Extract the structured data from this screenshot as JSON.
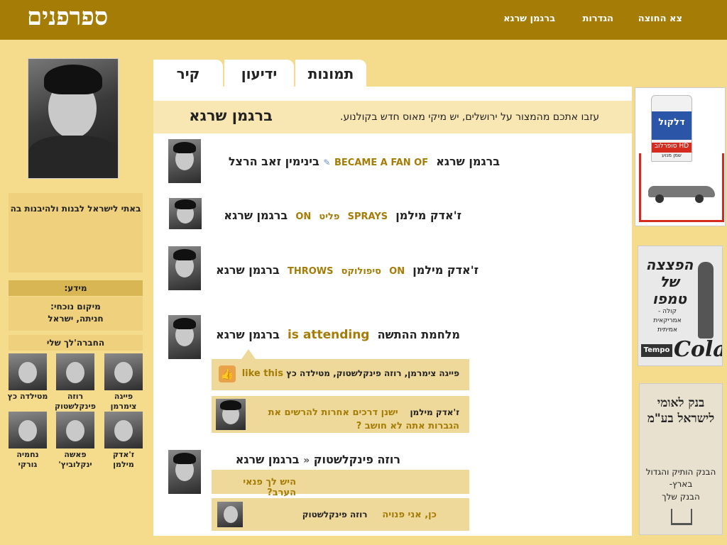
{
  "header": {
    "logo": "ספרפנים",
    "nav": [
      "צא החוצה",
      "הגדרות",
      "ברגמן שרגא"
    ]
  },
  "profile": {
    "bio": "באתי לישראל לבנות ולהיבנות בה",
    "info_title": "מידע:",
    "location_label": "מיקום נוכחי:",
    "location": "חניתה, ישראל",
    "friends_title": "החברה'לך שלי",
    "friends": [
      {
        "name": "פייגה צימרמן"
      },
      {
        "name": "רוזה פינקלשטוק"
      },
      {
        "name": "מטילדה כץ"
      },
      {
        "name": "ז'אדק מילמן"
      },
      {
        "name": "פאשה ינקלוביץ'"
      },
      {
        "name": "נחמיה גורקי"
      }
    ]
  },
  "tabs": [
    "תמונות",
    "ידיעון",
    "קיר"
  ],
  "status": {
    "name": "ברגמן שרגא",
    "text": "עזבו אתכם מהמצור על ירושלים, יש מיקי מאוס חדש בקולנוע."
  },
  "feed": [
    {
      "actor": "ברגמן שרגא",
      "verb": "BECAME A FAN OF",
      "object": "בינימין זאב הרצל"
    },
    {
      "actor": "ז'אדק מילמן",
      "verb": "SPRAYS",
      "object": "פליט",
      "prep": "ON",
      "target": "ברגמן שרגא"
    },
    {
      "actor": "ברגמן שרגא",
      "verb": "THROWS",
      "object": "סיפולוקס",
      "prep": "ON",
      "target": "ז'אדק מילמן"
    },
    {
      "actor": "ברגמן שרגא",
      "verb": "is attending",
      "object": "מלחמת ההתשה"
    },
    {
      "actor": "ברגמן שרגא",
      "object": "רוזה פינקלשטוק"
    }
  ],
  "likes": {
    "label": "like this",
    "names": "פייגה צימרמן, רוזה פינקלשטוק, מטילדה כץ"
  },
  "comments": [
    {
      "author": "ז'אדק מילמן",
      "text": "ישנן דרכים אחרות להרשים את הגברות אתה לא חושב ?"
    },
    {
      "author": "",
      "text": "היש לך פנאי הערב?"
    },
    {
      "author": "רוזה פינקלשטוק",
      "text": "כן, אני פנויה"
    }
  ],
  "ads": [
    {
      "name": "דלקול",
      "line1": "סופרלוב HD",
      "line2": "שמן מנוע"
    },
    {
      "name": "Tempo Cola",
      "headline": "הפצצה של טמפו",
      "sub": "קולה - אמריקאית אמיתית",
      "brand": "Cola",
      "tempo": "Tempo"
    },
    {
      "name": "בנק לאומי לישראל בע\"מ",
      "line1": "הבנק הותיק והגדול בארץ-",
      "line2": "הבנק שלך"
    }
  ]
}
